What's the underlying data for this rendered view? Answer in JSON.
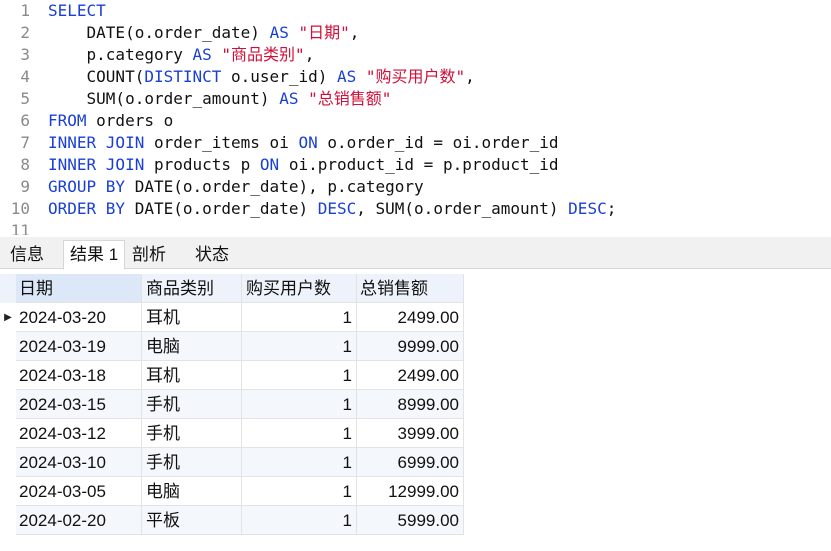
{
  "editor": {
    "lines": [
      {
        "n": "1",
        "tokens": [
          {
            "t": "SELECT",
            "k": "kw"
          }
        ]
      },
      {
        "n": "2",
        "tokens": [
          {
            "t": "    DATE(o.order_date) ",
            "k": "tx"
          },
          {
            "t": "AS",
            "k": "kw"
          },
          {
            "t": " ",
            "k": "tx"
          },
          {
            "t": "\"日期\"",
            "k": "str"
          },
          {
            "t": ",",
            "k": "tx"
          }
        ]
      },
      {
        "n": "3",
        "tokens": [
          {
            "t": "    p.category ",
            "k": "tx"
          },
          {
            "t": "AS",
            "k": "kw"
          },
          {
            "t": " ",
            "k": "tx"
          },
          {
            "t": "\"商品类别\"",
            "k": "str"
          },
          {
            "t": ",",
            "k": "tx"
          }
        ]
      },
      {
        "n": "4",
        "tokens": [
          {
            "t": "    COUNT(",
            "k": "tx"
          },
          {
            "t": "DISTINCT",
            "k": "kw"
          },
          {
            "t": " o.user_id) ",
            "k": "tx"
          },
          {
            "t": "AS",
            "k": "kw"
          },
          {
            "t": " ",
            "k": "tx"
          },
          {
            "t": "\"购买用户数\"",
            "k": "str"
          },
          {
            "t": ",",
            "k": "tx"
          }
        ]
      },
      {
        "n": "5",
        "tokens": [
          {
            "t": "    SUM(o.order_amount) ",
            "k": "tx"
          },
          {
            "t": "AS",
            "k": "kw"
          },
          {
            "t": " ",
            "k": "tx"
          },
          {
            "t": "\"总销售额\"",
            "k": "str"
          }
        ]
      },
      {
        "n": "6",
        "tokens": [
          {
            "t": "FROM",
            "k": "kw"
          },
          {
            "t": " orders o",
            "k": "tx"
          }
        ]
      },
      {
        "n": "7",
        "tokens": [
          {
            "t": "INNER JOIN",
            "k": "kw"
          },
          {
            "t": " order_items oi ",
            "k": "tx"
          },
          {
            "t": "ON",
            "k": "kw"
          },
          {
            "t": " o.order_id = oi.order_id",
            "k": "tx"
          }
        ]
      },
      {
        "n": "8",
        "tokens": [
          {
            "t": "INNER JOIN",
            "k": "kw"
          },
          {
            "t": " products p ",
            "k": "tx"
          },
          {
            "t": "ON",
            "k": "kw"
          },
          {
            "t": " oi.product_id = p.product_id",
            "k": "tx"
          }
        ]
      },
      {
        "n": "9",
        "tokens": [
          {
            "t": "GROUP BY",
            "k": "kw"
          },
          {
            "t": " DATE(o.order_date), p.category",
            "k": "tx"
          }
        ]
      },
      {
        "n": "10",
        "tokens": [
          {
            "t": "ORDER BY",
            "k": "kw"
          },
          {
            "t": " DATE(o.order_date) ",
            "k": "tx"
          },
          {
            "t": "DESC",
            "k": "kw"
          },
          {
            "t": ", SUM(o.order_amount) ",
            "k": "tx"
          },
          {
            "t": "DESC",
            "k": "kw"
          },
          {
            "t": ";",
            "k": "tx"
          }
        ]
      },
      {
        "n": "11",
        "tokens": []
      }
    ]
  },
  "tabs": {
    "info": "信息",
    "result1": "结果 1",
    "profile": "剖析",
    "status": "状态"
  },
  "grid": {
    "columns": [
      "日期",
      "商品类别",
      "购买用户数",
      "总销售额"
    ],
    "current_row_marker": "▶",
    "rows": [
      [
        "2024-03-20",
        "耳机",
        "1",
        "2499.00"
      ],
      [
        "2024-03-19",
        "电脑",
        "1",
        "9999.00"
      ],
      [
        "2024-03-18",
        "耳机",
        "1",
        "2499.00"
      ],
      [
        "2024-03-15",
        "手机",
        "1",
        "8999.00"
      ],
      [
        "2024-03-12",
        "手机",
        "1",
        "3999.00"
      ],
      [
        "2024-03-10",
        "手机",
        "1",
        "6999.00"
      ],
      [
        "2024-03-05",
        "电脑",
        "1",
        "12999.00"
      ],
      [
        "2024-02-20",
        "平板",
        "1",
        "5999.00"
      ]
    ]
  },
  "colors": {
    "keyword": "#1a3fd6",
    "string": "#d0103a",
    "line_number": "#8a8a8a",
    "header_bg": "#eef3fb"
  }
}
